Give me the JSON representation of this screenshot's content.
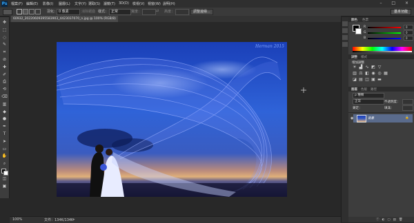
{
  "app": {
    "logo": "Ps",
    "window_controls": "– □ ×"
  },
  "menu": [
    "檔案(F)",
    "編輯(E)",
    "影像(I)",
    "圖層(L)",
    "文字(Y)",
    "選取(S)",
    "濾鏡(T)",
    "3D(D)",
    "檢視(V)",
    "視窗(W)",
    "說明(H)"
  ],
  "options": {
    "feather_label": "羽化：",
    "feather_value": "0 像素",
    "anti_alias_label": "消除鋸齒",
    "style_label": "樣式：",
    "style_value": "正常",
    "width_label": "寬度：",
    "height_label": "高度：",
    "refine_edge_button": "調整邊緣...",
    "workspace": "基本功能"
  },
  "document": {
    "tab_title": "60932_20220609395583903_4423037070_n.jpg @ 100% (RGB/8)",
    "watermark": "Herman 2015",
    "zoom": "100%",
    "doc_info": "文件：134K/134K"
  },
  "panels": {
    "color_tab": "顏色",
    "swatches_tab": "色票",
    "slider_labels": [
      "R",
      "G",
      "B"
    ],
    "slider_values": [
      0,
      0,
      0
    ],
    "adjustments_tab": "調整",
    "styles_tab": "樣式",
    "adjustments_title": "增加調整",
    "layers_tab": "圖層",
    "channels_tab": "色版",
    "paths_tab": "路徑",
    "filter_kind": "ρ 種類",
    "blend_mode": "正常",
    "opacity_label": "不透明度：",
    "lock_label": "鎖定：",
    "fill_label": "填滿：",
    "layer_name": "背景",
    "colors": {
      "spectrum_r": "#e04b4b",
      "spectrum_g": "#4bd06a",
      "spectrum_b": "#4b7bdb",
      "selection": "#5a6b8c"
    }
  },
  "tools": [
    "move-tool",
    "marquee-tool",
    "lasso-tool",
    "quick-select-tool",
    "crop-tool",
    "eyedropper-tool",
    "healing-brush-tool",
    "brush-tool",
    "clone-stamp-tool",
    "history-brush-tool",
    "eraser-tool",
    "gradient-tool",
    "blur-tool",
    "dodge-tool",
    "pen-tool",
    "type-tool",
    "path-select-tool",
    "rectangle-tool",
    "hand-tool",
    "zoom-tool",
    "foreground-background-colors",
    "quick-mask",
    "screen-mode"
  ]
}
